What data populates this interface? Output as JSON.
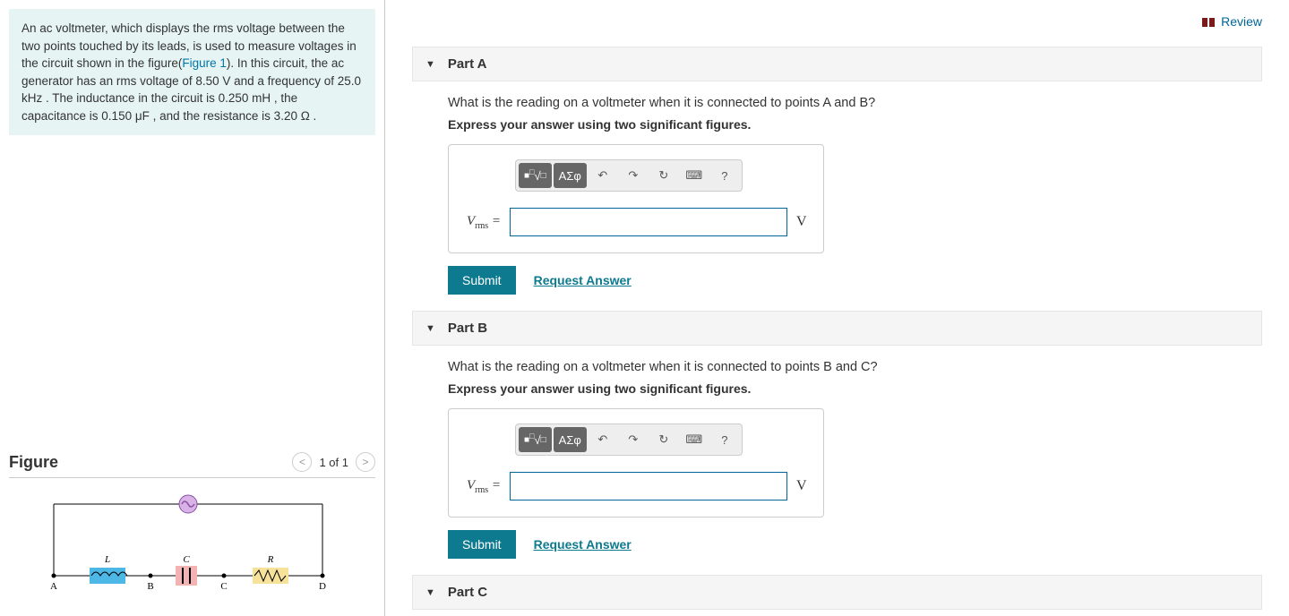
{
  "review": {
    "label": "Review"
  },
  "problem": {
    "text_pre": "An ac voltmeter, which displays the rms voltage between the two points touched by its leads, is used to measure voltages in the circuit shown in the figure(",
    "figure_link": "Figure 1",
    "text_post": "). In this circuit, the ac generator has an rms voltage of 8.50 V and a frequency of 25.0 kHz . The inductance in the circuit is 0.250 mH , the capacitance is 0.150 μF , and the resistance is 3.20 Ω ."
  },
  "figure": {
    "title": "Figure",
    "nav_text": "1 of 1",
    "labels": {
      "L": "L",
      "C": "C",
      "R": "R",
      "A": "A",
      "B": "B",
      "Cpt": "C",
      "D": "D"
    }
  },
  "parts": {
    "a": {
      "title": "Part A",
      "question": "What is the reading on a voltmeter when it is connected to points A and B?",
      "instruction": "Express your answer using two significant figures.",
      "var_main": "V",
      "var_sub": "rms",
      "equals": " = ",
      "unit": "V",
      "submit": "Submit",
      "request": "Request Answer"
    },
    "b": {
      "title": "Part B",
      "question": "What is the reading on a voltmeter when it is connected to points B and C?",
      "instruction": "Express your answer using two significant figures.",
      "var_main": "V",
      "var_sub": "rms",
      "equals": " = ",
      "unit": "V",
      "submit": "Submit",
      "request": "Request Answer"
    },
    "c": {
      "title": "Part C"
    }
  },
  "toolbar": {
    "templates": "■",
    "sqrt": "√",
    "greek": "ΑΣφ",
    "undo": "↶",
    "redo": "↷",
    "reset": "↻",
    "keyboard": "⌨",
    "help": "?"
  }
}
